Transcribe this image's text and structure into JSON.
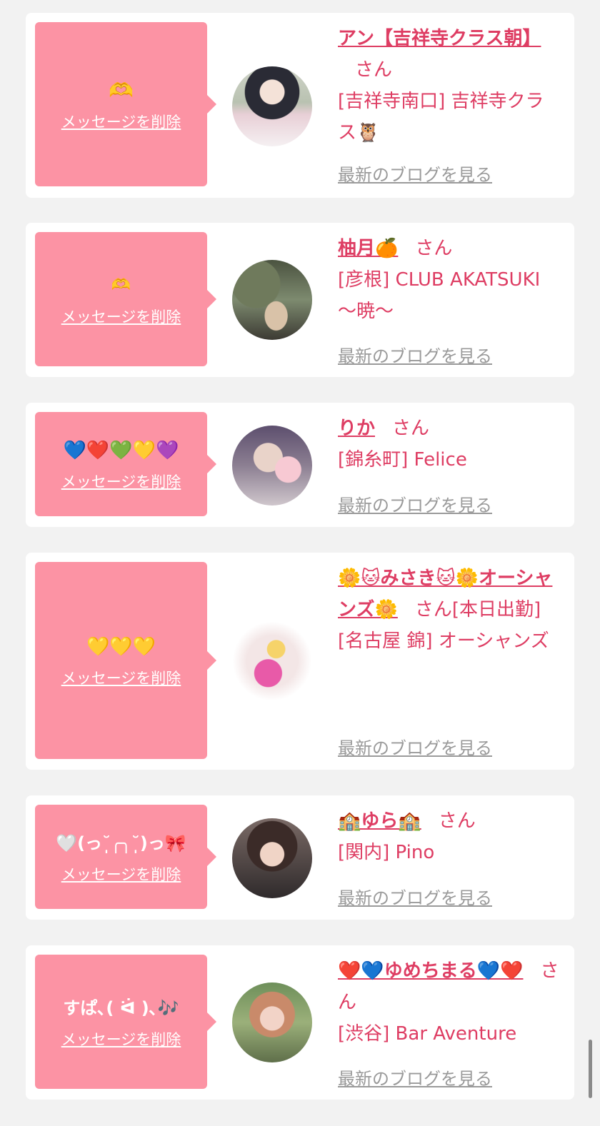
{
  "delete_label": "メッセージを削除",
  "blog_label": "最新のブログを見る",
  "honorific": "さん",
  "cards": [
    {
      "message": "🫶",
      "name": "アン【吉祥寺クラス朝】",
      "honorific": "さん",
      "shop": "[吉祥寺南口] 吉祥寺クラス🦉"
    },
    {
      "message": "🫶",
      "name": "柚月🍊",
      "honorific": "さん",
      "shop": "[彦根] CLUB AKATSUKI ～暁～"
    },
    {
      "message": "💙❤️💚💛💜",
      "name": "りか",
      "honorific": "さん",
      "shop": "[錦糸町] Felice"
    },
    {
      "message": "💛💛💛",
      "name": "🌼🐱みさき🐱🌼オーシャンズ🌼",
      "honorific": "さん[本日出勤]",
      "shop": "[名古屋 錦] オーシャンズ"
    },
    {
      "message": "🤍(っ˘̩╭╮˘̩)っ🎀",
      "name": "🏫ゆら🏫",
      "honorific": "さん",
      "shop": "[関内] Pino"
    },
    {
      "message": "すぱ､( ᐛ )､🎶",
      "name": "❤️💙ゆめちまる💙❤️",
      "honorific": "さん",
      "shop": "[渋谷] Bar Aventure"
    }
  ],
  "colors": {
    "bubble": "#fc93a4",
    "name": "#de3d63",
    "blog_link": "#9a9a9a",
    "background": "#f2f2f2"
  }
}
